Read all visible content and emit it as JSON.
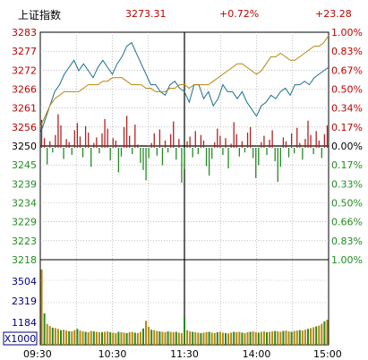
{
  "header": {
    "name": "上证指数",
    "price": "3273.31",
    "pct": "+0.72%",
    "change": "+23.28"
  },
  "chart_data": {
    "type": "line",
    "base": 3250,
    "ylim": [
      3218,
      3283
    ],
    "price_ticks": [
      "3283",
      "3277",
      "3272",
      "3266",
      "3261",
      "3256",
      "3250",
      "3245",
      "3239",
      "3234",
      "3229",
      "3223",
      "3218"
    ],
    "pct_ticks": [
      "1.00%",
      "0.83%",
      "0.67%",
      "0.50%",
      "0.34%",
      "0.17%",
      "0.00%",
      "0.17%",
      "0.33%",
      "0.50%",
      "0.66%",
      "0.83%",
      "1.00%"
    ],
    "time_ticks": [
      "09:30",
      "10:30",
      "11:30",
      "14:00",
      "15:00"
    ],
    "volume_ticks": [
      "3504",
      "2319",
      "1184"
    ],
    "volume_unit": "X1000",
    "series": [
      {
        "color": "#1a6f8c",
        "x": [
          0,
          4,
          8,
          12,
          16,
          20,
          24,
          28,
          32,
          36,
          40,
          44,
          48,
          52,
          56,
          60,
          64,
          68,
          72,
          76,
          80,
          84,
          88,
          92,
          96,
          100,
          104,
          108,
          112,
          116,
          120,
          124,
          128,
          132,
          136,
          140,
          144,
          148,
          152,
          156,
          160,
          164,
          168,
          172,
          176,
          180,
          184,
          188,
          192,
          196,
          200,
          204,
          208,
          212,
          216,
          220,
          224,
          228,
          232,
          236,
          240
        ],
        "values": [
          3254,
          3258,
          3262,
          3266,
          3268,
          3271,
          3273,
          3275,
          3272,
          3274,
          3272,
          3270,
          3273,
          3275,
          3273,
          3271,
          3274,
          3276,
          3279,
          3280,
          3277,
          3274,
          3271,
          3268,
          3268,
          3266,
          3265,
          3268,
          3269,
          3267,
          3266,
          3263,
          3268,
          3268,
          3264,
          3266,
          3262,
          3264,
          3268,
          3266,
          3266,
          3264,
          3266,
          3263,
          3261,
          3259,
          3262,
          3263,
          3265,
          3264,
          3266,
          3267,
          3265,
          3268,
          3268,
          3269,
          3268,
          3270,
          3271,
          3272,
          3273
        ]
      },
      {
        "color": "#b8860b",
        "x": [
          0,
          4,
          8,
          12,
          16,
          20,
          24,
          28,
          32,
          36,
          40,
          44,
          48,
          52,
          56,
          60,
          64,
          68,
          72,
          76,
          80,
          84,
          88,
          92,
          96,
          100,
          104,
          108,
          112,
          116,
          120,
          124,
          128,
          132,
          136,
          140,
          144,
          148,
          152,
          156,
          160,
          164,
          168,
          172,
          176,
          180,
          184,
          188,
          192,
          196,
          200,
          204,
          208,
          212,
          216,
          220,
          224,
          228,
          232,
          236,
          240
        ],
        "values": [
          3256,
          3259,
          3262,
          3264,
          3265,
          3266,
          3266,
          3266,
          3266,
          3267,
          3268,
          3268,
          3268,
          3269,
          3269,
          3270,
          3270,
          3270,
          3269,
          3268,
          3268,
          3268,
          3267,
          3267,
          3266,
          3266,
          3266,
          3267,
          3267,
          3268,
          3268,
          3267,
          3268,
          3268,
          3268,
          3268,
          3269,
          3270,
          3271,
          3272,
          3273,
          3274,
          3274,
          3273,
          3272,
          3271,
          3272,
          3274,
          3276,
          3276,
          3277,
          3276,
          3275,
          3275,
          3276,
          3277,
          3278,
          3279,
          3279,
          3280,
          3282
        ]
      }
    ],
    "bars_up_color": "#b22222",
    "bars_down_color": "#228b22",
    "bars": [
      3.5,
      1.2,
      -2.1,
      0.8,
      -0.6,
      1.6,
      4.2,
      2.8,
      -1.4,
      1.1,
      0.7,
      -0.9,
      2.2,
      3.1,
      1.4,
      -1.2,
      2.7,
      1.9,
      -2.4,
      0.6,
      1.3,
      -0.7,
      1.8,
      3.6,
      2.4,
      -1.6,
      1.2,
      0.9,
      -3.1,
      -1.1,
      2.6,
      4.0,
      1.5,
      -0.8,
      2.9,
      0.4,
      -1.9,
      -2.8,
      -4.1,
      -1.3,
      0.6,
      1.8,
      -1.0,
      2.3,
      -2.2,
      0.9,
      -0.6,
      1.7,
      3.3,
      -1.5,
      1.1,
      -4.4,
      -2.7,
      0.8,
      1.4,
      -1.2,
      2.1,
      -0.8,
      1.6,
      0.9,
      -2.3,
      -3.5,
      -1.4,
      0.7,
      2.4,
      1.5,
      -0.9,
      1.2,
      -2.6,
      0.5,
      3.2,
      1.7,
      -1.1,
      0.8,
      -0.6,
      1.9,
      2.6,
      -1.3,
      -3.8,
      -2.2,
      0.7,
      1.5,
      -0.9,
      1.0,
      2.2,
      -1.7,
      -4.3,
      -2.4,
      1.3,
      0.8,
      -1.2,
      1.8,
      -0.7,
      2.5,
      0.6,
      -1.5,
      1.1,
      3.4,
      1.6,
      -0.8,
      2.1,
      0.9,
      -1.3,
      1.7,
      2.8
    ],
    "volume": [
      3600,
      1500,
      1000,
      900,
      820,
      800,
      760,
      700,
      720,
      680,
      650,
      640,
      700,
      760,
      680,
      640,
      620,
      600,
      660,
      640,
      620,
      600,
      600,
      620,
      640,
      600,
      580,
      560,
      620,
      600,
      580,
      560,
      600,
      620,
      580,
      560,
      620,
      780,
      1150,
      860,
      720,
      700,
      660,
      640,
      620,
      600,
      640,
      620,
      600,
      620,
      580,
      560,
      1300,
      700,
      640,
      620,
      600,
      580,
      560,
      580,
      600,
      620,
      580,
      560,
      600,
      620,
      580,
      560,
      540,
      580,
      620,
      600,
      620,
      580,
      560,
      600,
      620,
      640,
      600,
      580,
      620,
      640,
      600,
      620,
      640,
      660,
      640,
      620,
      660,
      680,
      640,
      620,
      660,
      680,
      700,
      680,
      720,
      760,
      800,
      840,
      880,
      920,
      1000,
      1120,
      1200
    ]
  }
}
